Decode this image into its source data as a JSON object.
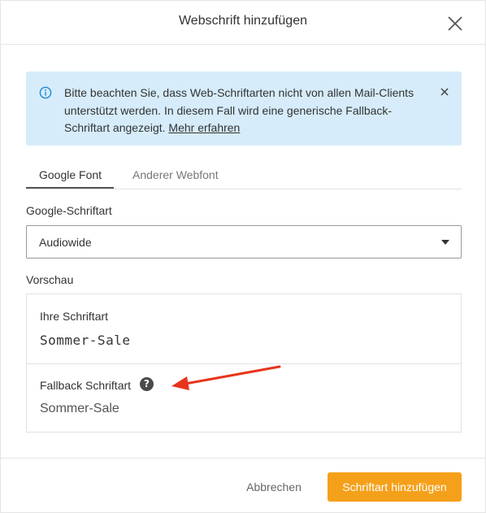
{
  "dialog": {
    "title": "Webschrift hinzufügen",
    "close_icon": "close-icon"
  },
  "info": {
    "icon": "info-icon",
    "text": "Bitte beachten Sie, dass Web-Schriftarten nicht von allen Mail-Clients unterstützt werden. In diesem Fall wird eine generische Fallback-Schriftart angezeigt.",
    "link": "Mehr erfahren",
    "background": "#d6ecfa",
    "icon_color": "#2a8fd8"
  },
  "tabs": [
    {
      "label": "Google Font",
      "active": true
    },
    {
      "label": "Anderer Webfont",
      "active": false
    }
  ],
  "font_select": {
    "label": "Google-Schriftart",
    "value": "Audiowide"
  },
  "preview": {
    "label": "Vorschau",
    "your_font_label": "Ihre Schriftart",
    "your_font_sample": "Sommer-Sale",
    "fallback_label": "Fallback Schriftart",
    "help_icon": "help-icon",
    "fallback_sample": "Sommer-Sale"
  },
  "annotation": {
    "arrow_color": "#e8341c"
  },
  "footer": {
    "cancel_label": "Abbrechen",
    "add_label": "Schriftart hinzufügen",
    "accent": "#f5a01a"
  }
}
